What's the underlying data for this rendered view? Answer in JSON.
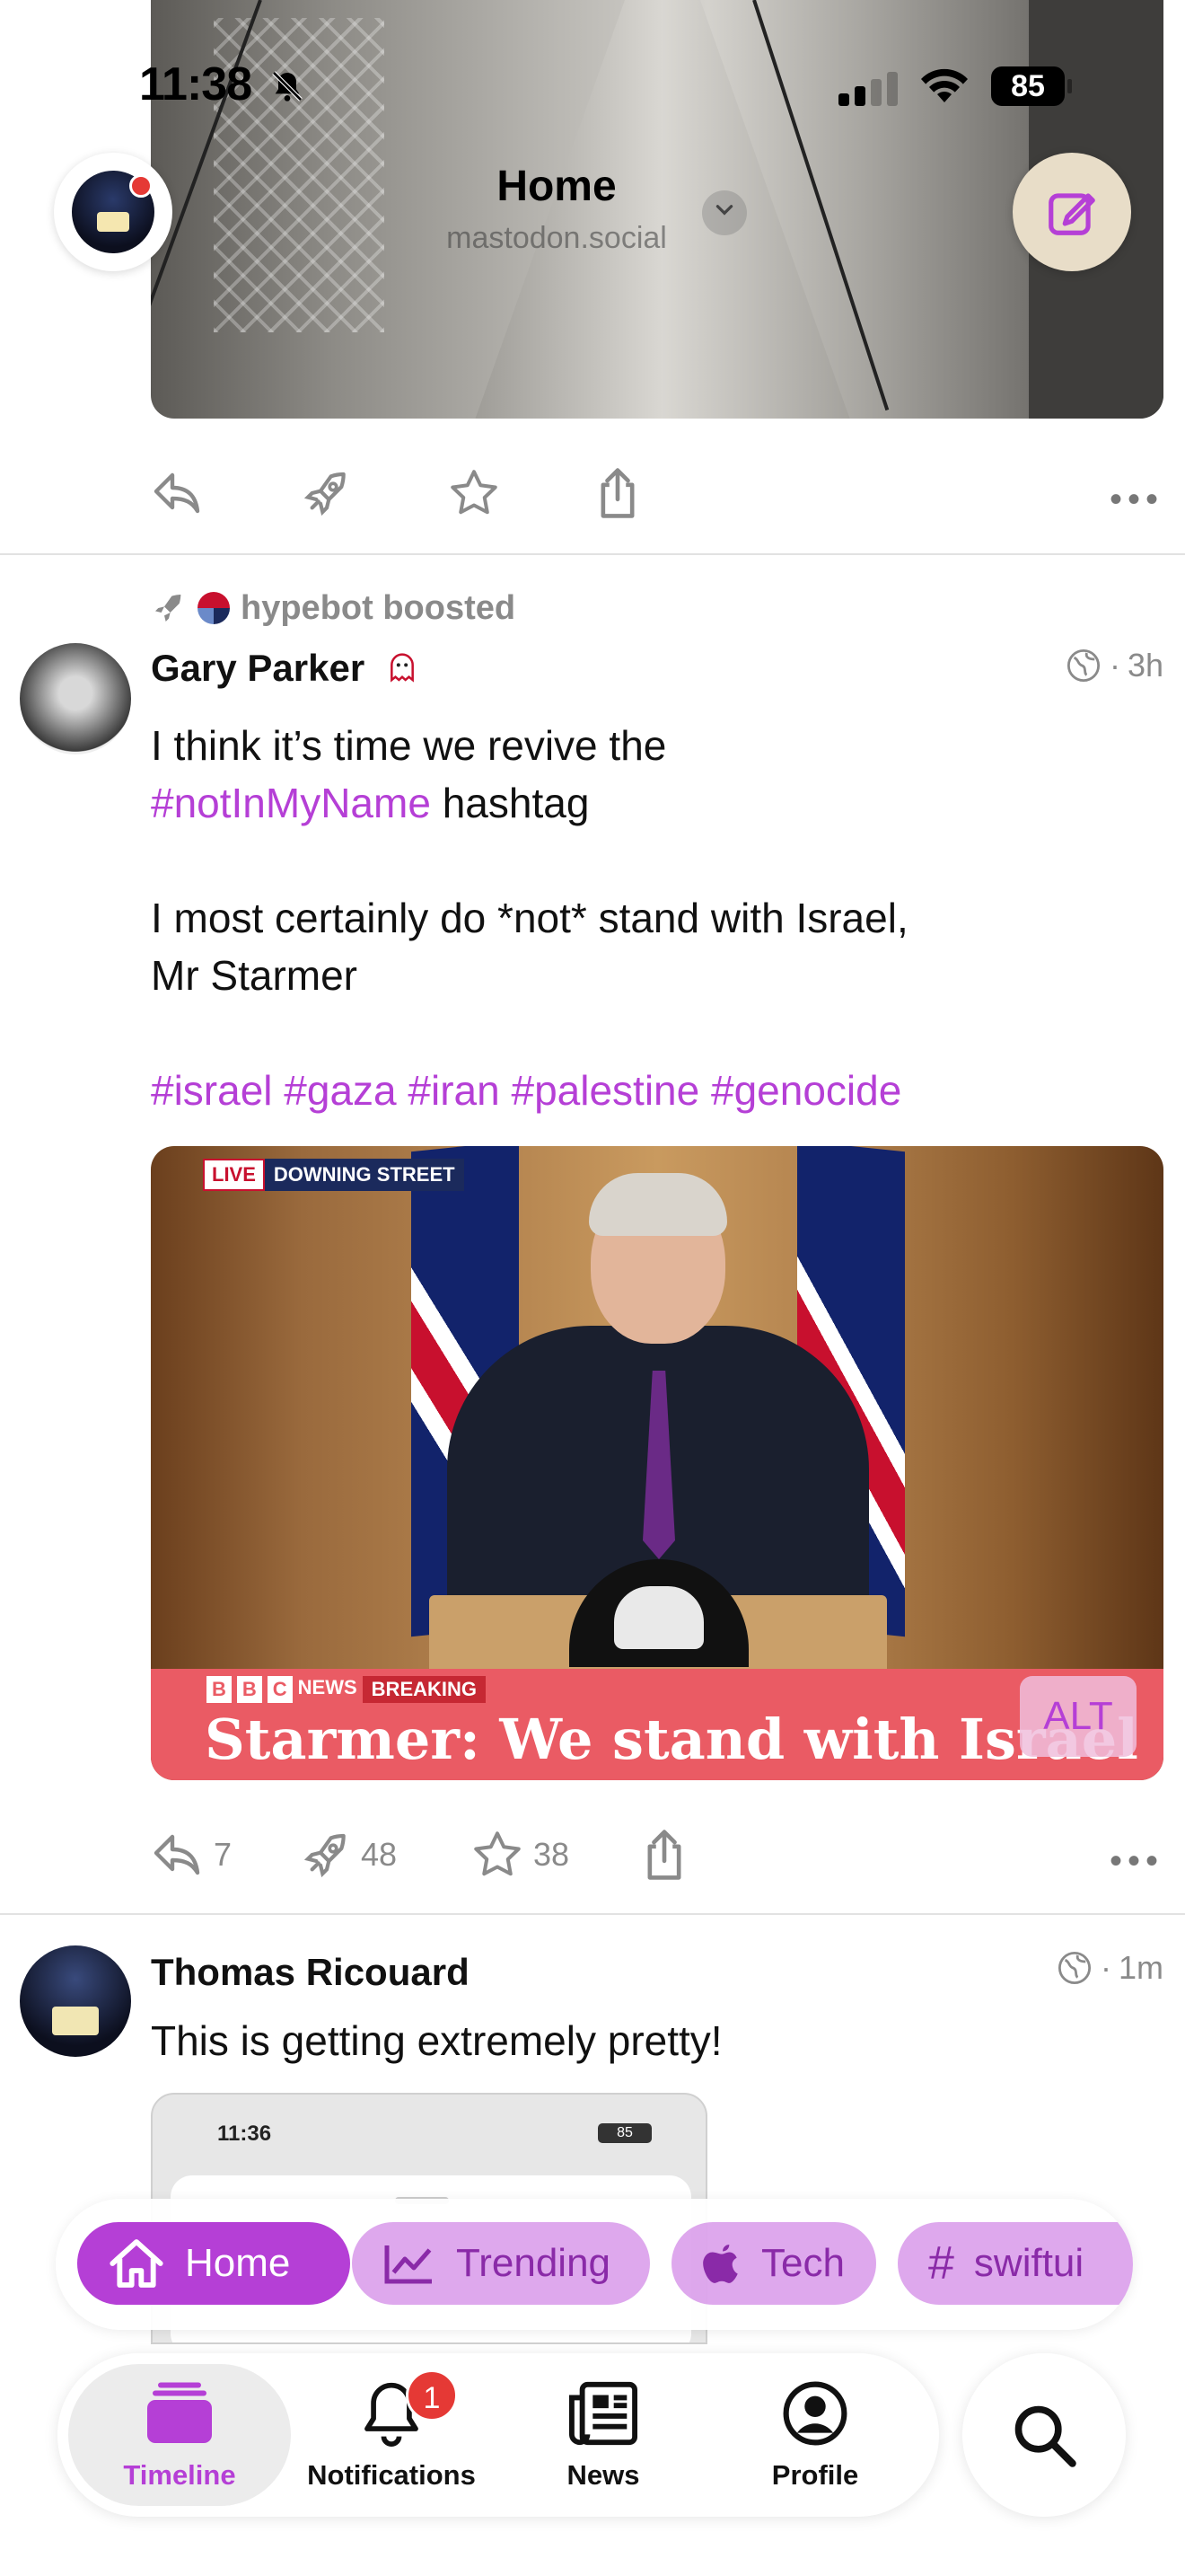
{
  "status_bar": {
    "time": "11:38",
    "battery": "85"
  },
  "nav": {
    "title": "Home",
    "subtitle": "mastodon.social"
  },
  "colors": {
    "accent": "#b53fd6",
    "badge": "#e53935"
  },
  "prev_post_actions": {
    "reply_count": "",
    "boost_count": "",
    "favorite_count": ""
  },
  "post1": {
    "boosted_by": "hypebot boosted",
    "author": "Gary Parker",
    "time": "3h",
    "visibility_icon": "globe-icon",
    "text_line1": "I think it’s time we revive the",
    "tag_notinmyname": "#notInMyName",
    "text_line2_rest": " hashtag",
    "text_line3": "I most certainly do *not* stand with Israel,",
    "text_line4": "Mr Starmer",
    "hashtags": [
      "#israel",
      "#gaza",
      "#iran",
      "#palestine",
      "#genocide"
    ],
    "media": {
      "live": "LIVE",
      "location": "DOWNING STREET",
      "bbc": [
        "B",
        "B",
        "C"
      ],
      "news": "NEWS",
      "breaking": "BREAKING",
      "headline": "Starmer: We stand with Israel",
      "alt": "ALT"
    },
    "actions": {
      "replies": "7",
      "boosts": "48",
      "favorites": "38"
    }
  },
  "post2": {
    "author": "Thomas Ricouard",
    "time": "1m",
    "text": "This is getting extremely pretty!",
    "thumb_time": "11:36",
    "thumb_battery": "85"
  },
  "timeline_chips": [
    {
      "label": "Home",
      "icon": "house-icon"
    },
    {
      "label": "Trending",
      "icon": "chart-icon"
    },
    {
      "label": "Tech",
      "icon": "apple-icon"
    },
    {
      "label": "swiftui",
      "icon": "hashtag-icon"
    }
  ],
  "tabs": {
    "timeline": "Timeline",
    "notifications": "Notifications",
    "notifications_badge": "1",
    "news": "News",
    "profile": "Profile"
  }
}
